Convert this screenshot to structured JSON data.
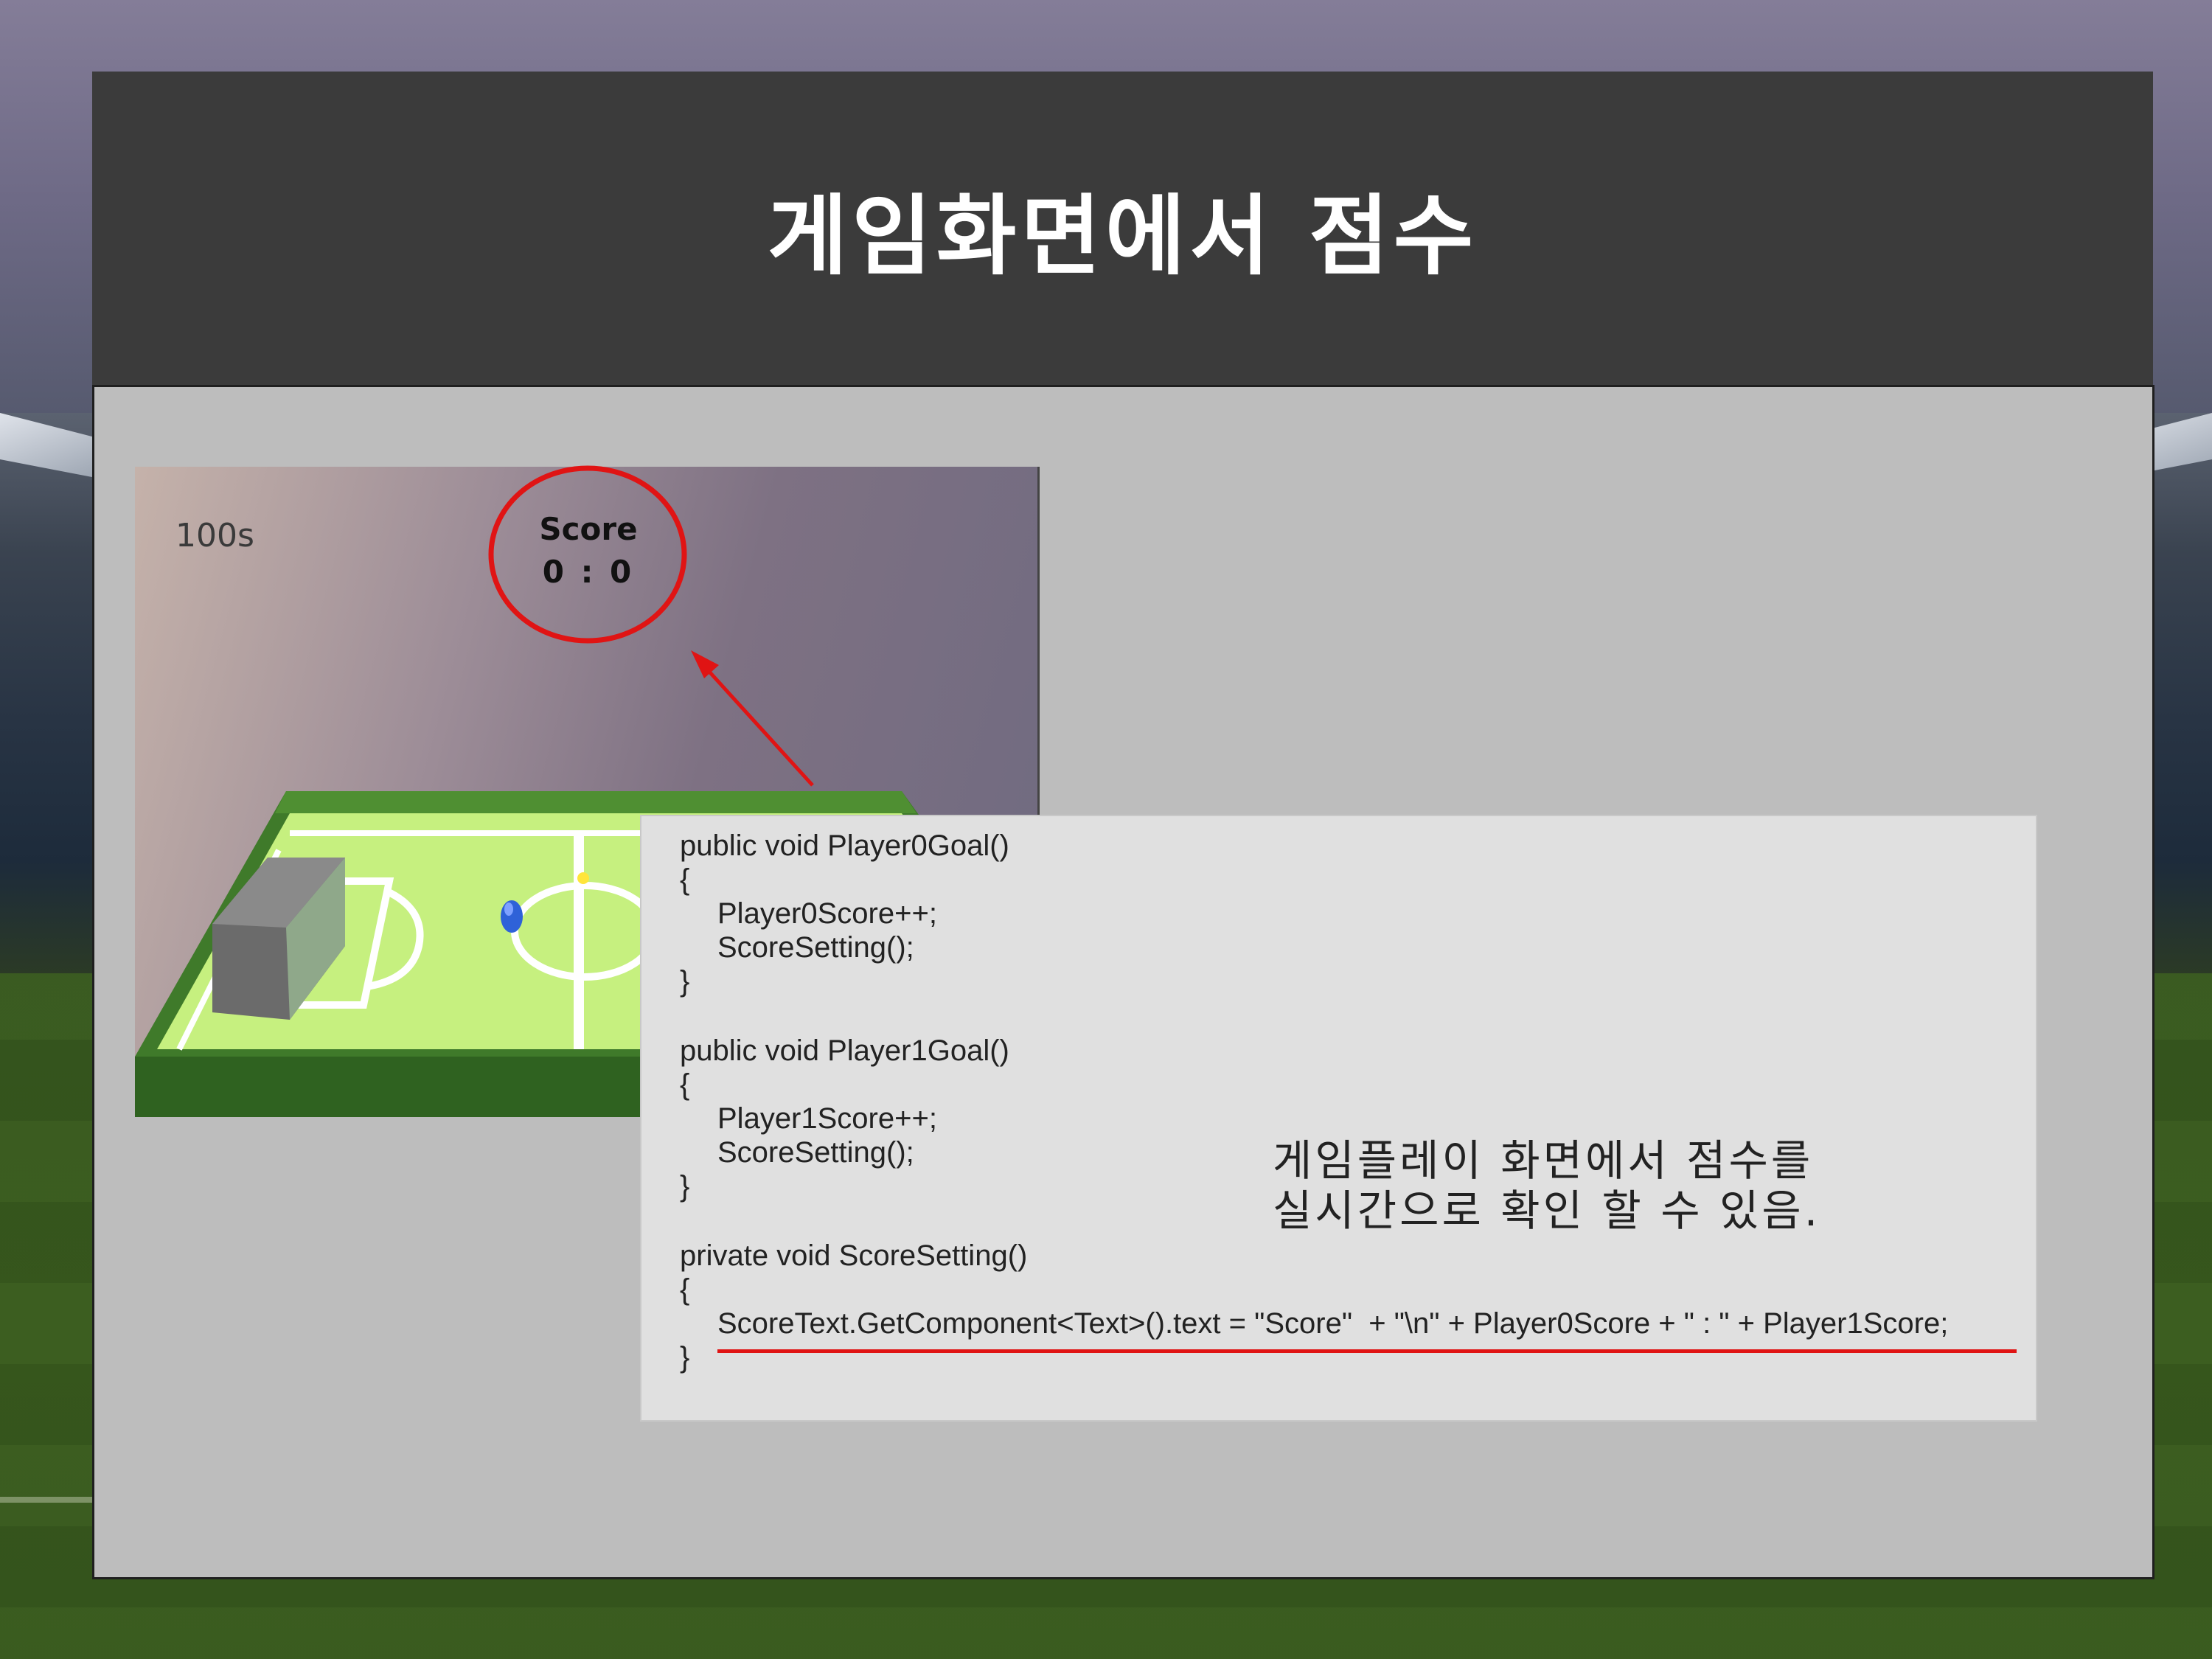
{
  "slide": {
    "title": "게임화면에서 점수"
  },
  "game_view": {
    "timer": "100s",
    "score_label": "Score",
    "score_value": "0 : 0"
  },
  "code": {
    "lines": [
      "public void Player0Goal()",
      "{",
      "Player0Score++;",
      "ScoreSetting();",
      "}",
      "public void Player1Goal()",
      "{",
      "Player1Score++;",
      "ScoreSetting();",
      "}",
      "private void ScoreSetting()",
      "{",
      "ScoreText.GetComponent<Text>().text = \"Score\"  + \"\\n\" + Player0Score + \" : \" + Player1Score;",
      "}"
    ]
  },
  "caption": {
    "line1": "게임플레이 화면에서 점수를",
    "line2": "실시간으로 확인 할 수 있음."
  },
  "colors": {
    "header_bg": "#3b3b3b",
    "body_bg": "#bdbdbd",
    "annotation": "#e01414",
    "code_bg": "#e0e0e0"
  }
}
